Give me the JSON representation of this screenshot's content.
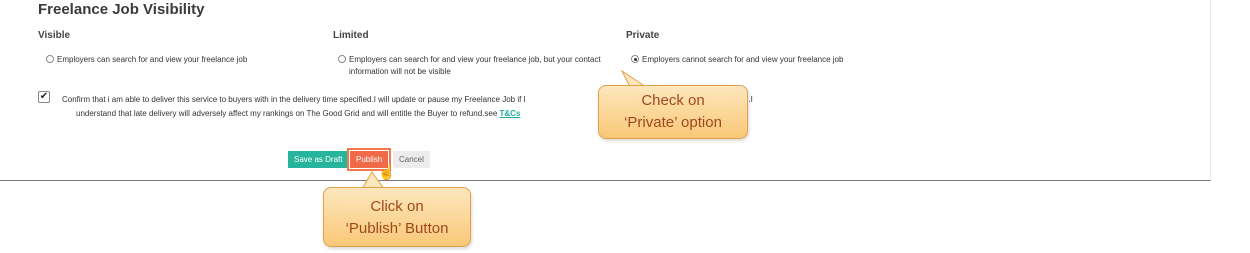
{
  "section_title": "Freelance Job Visibility",
  "columns": [
    {
      "heading": "Visible",
      "option_text": "Employers can search for and view your freelance job",
      "option_text_2": "",
      "selected": false
    },
    {
      "heading": "Limited",
      "option_text": "Employers can search for and view your freelance job, but your contact",
      "option_text_2": "information will not be visible",
      "selected": false
    },
    {
      "heading": "Private",
      "option_text": "Employers cannot search for and view your freelance job",
      "option_text_2": "",
      "selected": true
    }
  ],
  "confirm": {
    "checked": true,
    "line1": "Confirm that i am able to deliver this service to buyers with in the delivery time specified.I will update or pause my Freelance Job if I",
    "line1_tail": "e.I",
    "line2": "understand that late delivery will adversely affect my rankings on The Good Grid and will entitle the Buyer to refund.see ",
    "link": "T&Cs"
  },
  "buttons": {
    "save_draft": "Save as Draft",
    "publish": "Publish",
    "cancel": "Cancel"
  },
  "callouts": {
    "private_line1": "Check on",
    "private_line2": "‘Private’ option",
    "publish_line1": "Click on",
    "publish_line2": "‘Publish’ Button"
  },
  "colors": {
    "teal": "#27b49d",
    "publish": "#f06a4a",
    "callout_fill": "#fbd594",
    "callout_text": "#a0481c"
  }
}
